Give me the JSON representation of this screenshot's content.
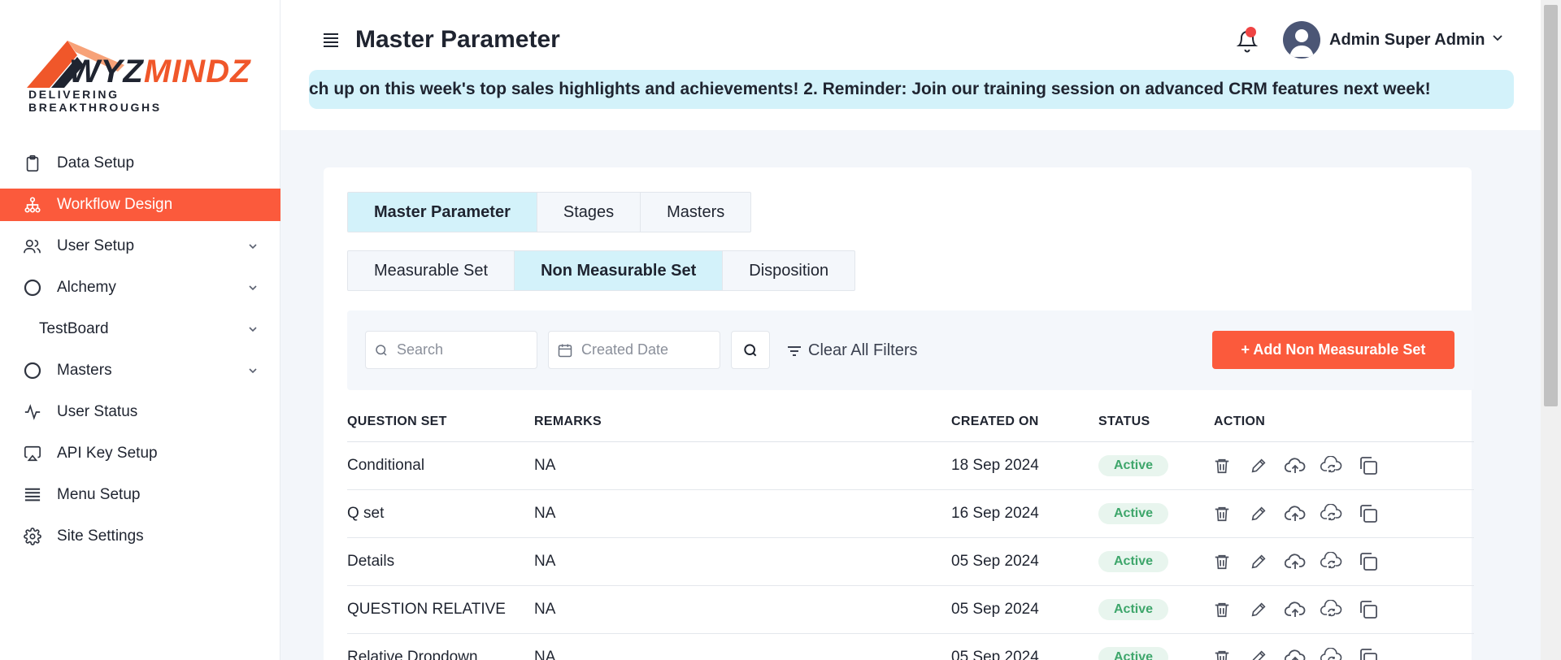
{
  "logo": {
    "brand_part1": "WYZ",
    "brand_part2": "MINDZ",
    "tagline": "DELIVERING BREAKTHROUGHS"
  },
  "sidebar": {
    "items": [
      {
        "label": "Data Setup",
        "icon": "clipboard-icon"
      },
      {
        "label": "Workflow Design",
        "icon": "hierarchy-icon",
        "active": true
      },
      {
        "label": "User Setup",
        "icon": "users-icon",
        "expandable": true
      },
      {
        "label": "Alchemy",
        "icon": "circle-icon",
        "expandable": true
      },
      {
        "label": "TestBoard",
        "icon": "",
        "expandable": true
      },
      {
        "label": "Masters",
        "icon": "circle-icon",
        "expandable": true
      },
      {
        "label": "User Status",
        "icon": "activity-icon"
      },
      {
        "label": "API Key Setup",
        "icon": "airplay-icon"
      },
      {
        "label": "Menu Setup",
        "icon": "list-icon"
      },
      {
        "label": "Site Settings",
        "icon": "gear-icon"
      }
    ]
  },
  "header": {
    "title": "Master Parameter",
    "user_name": "Admin Super Admin",
    "ticker": "ch up on this week's top sales highlights and achievements! 2. Reminder: Join our training session on advanced CRM features next week!"
  },
  "tabs_primary": [
    "Master Parameter",
    "Stages",
    "Masters"
  ],
  "tabs_secondary": [
    "Measurable Set",
    "Non Measurable Set",
    "Disposition"
  ],
  "filters": {
    "search_placeholder": "Search",
    "date_placeholder": "Created Date",
    "clear_label": "Clear All Filters",
    "add_label": "+ Add Non Measurable Set"
  },
  "table": {
    "headers": [
      "QUESTION SET",
      "REMARKS",
      "CREATED ON",
      "STATUS",
      "ACTION"
    ],
    "rows": [
      {
        "question_set": "Conditional",
        "remarks": "NA",
        "created_on": "18 Sep 2024",
        "status": "Active"
      },
      {
        "question_set": "Q set",
        "remarks": "NA",
        "created_on": "16 Sep 2024",
        "status": "Active"
      },
      {
        "question_set": "Details",
        "remarks": "NA",
        "created_on": "05 Sep 2024",
        "status": "Active"
      },
      {
        "question_set": "QUESTION RELATIVE",
        "remarks": "NA",
        "created_on": "05 Sep 2024",
        "status": "Active"
      },
      {
        "question_set": "Relative Dropdown",
        "remarks": "NA",
        "created_on": "05 Sep 2024",
        "status": "Active"
      }
    ]
  },
  "colors": {
    "accent": "#fb5a3c",
    "tab_active": "#d3f2fa",
    "status_green": "#3ea66b"
  }
}
